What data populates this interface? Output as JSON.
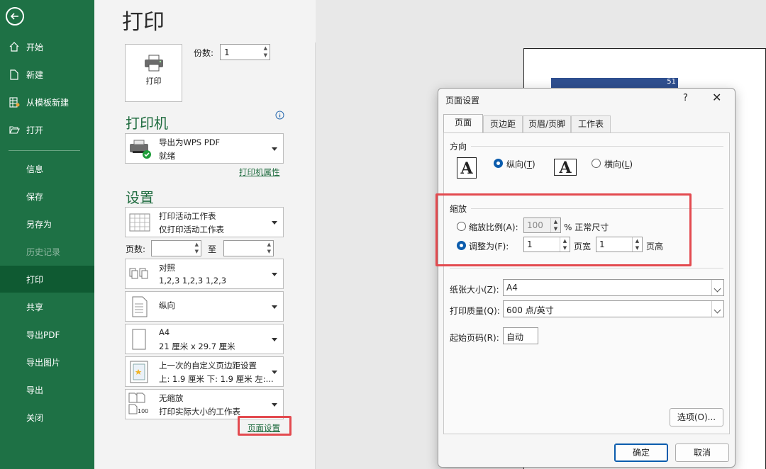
{
  "sidebar": {
    "items": [
      {
        "label": "开始",
        "icon": "home-icon"
      },
      {
        "label": "新建",
        "icon": "new-file-icon"
      },
      {
        "label": "从模板新建",
        "icon": "template-icon"
      },
      {
        "label": "打开",
        "icon": "folder-open-icon"
      },
      {
        "label": "信息"
      },
      {
        "label": "保存"
      },
      {
        "label": "另存为"
      },
      {
        "label": "历史记录"
      },
      {
        "label": "打印"
      },
      {
        "label": "共享"
      },
      {
        "label": "导出PDF"
      },
      {
        "label": "导出图片"
      },
      {
        "label": "导出"
      },
      {
        "label": "关闭"
      }
    ],
    "active_label": "打印",
    "disabled_label": "历史记录"
  },
  "backstage": {
    "title": "打印",
    "print_button_label": "打印",
    "copies_label": "份数:",
    "copies_value": "1",
    "printer_section_title": "打印机",
    "printer_name": "导出为WPS PDF",
    "printer_status": "就绪",
    "printer_properties_link": "打印机属性",
    "settings_section_title": "设置",
    "pages_label": "页数:",
    "pages_to_label": "至",
    "settings": [
      {
        "line1": "打印活动工作表",
        "line2": "仅打印活动工作表"
      },
      {
        "line1": "对照",
        "line2": "1,2,3    1,2,3    1,2,3"
      },
      {
        "line1": "纵向",
        "line2": ""
      },
      {
        "line1": "A4",
        "line2": "21 厘米 x 29.7 厘米"
      },
      {
        "line1": "上一次的自定义页边距设置",
        "line2": "上: 1.9 厘米 下: 1.9 厘米 左:..."
      },
      {
        "line1": "无缩放",
        "line2": "打印实际大小的工作表"
      }
    ],
    "page_setup_link": "页面设置"
  },
  "preview": {
    "cell_value": "51"
  },
  "dialog": {
    "title": "页面设置",
    "help": "?",
    "close": "✕",
    "tabs": [
      "页面",
      "页边距",
      "页眉/页脚",
      "工作表"
    ],
    "orientation_group": "方向",
    "portrait_label": "纵向(T)",
    "portrait_key": "T",
    "landscape_label": "横向(L)",
    "landscape_key": "L",
    "orientation_selected": "portrait",
    "scaling_group": "缩放",
    "adjust_to_label": "缩放比例(A):",
    "adjust_to_value": "100",
    "adjust_to_suffix": "% 正常尺寸",
    "fit_to_label": "调整为(F):",
    "fit_wide_value": "1",
    "fit_wide_suffix": "页宽",
    "fit_tall_value": "1",
    "fit_tall_suffix": "页高",
    "scaling_selected": "fit_to",
    "paper_size_label": "纸张大小(Z):",
    "paper_size_value": "A4",
    "print_quality_label": "打印质量(Q):",
    "print_quality_value": "600 点/英寸",
    "first_page_label": "起始页码(R):",
    "first_page_value": "自动",
    "options_button": "选项(O)...",
    "ok_button": "确定",
    "cancel_button": "取消"
  },
  "colors": {
    "sidebar": "#1e7145",
    "accent": "#1e6b3e",
    "highlight": "#e34a4f",
    "radio": "#0b5cad"
  }
}
